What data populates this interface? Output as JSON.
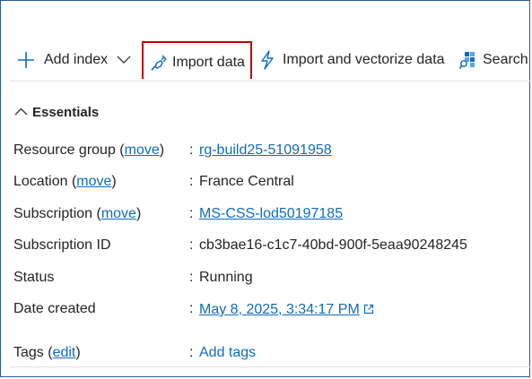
{
  "toolbar": {
    "add_index_label": "Add index",
    "import_data_label": "Import data",
    "import_vectorize_label": "Import and vectorize data",
    "search_label": "Search explorer"
  },
  "essentials": {
    "header": "Essentials",
    "open": "(",
    "close": ")",
    "resource_group": {
      "label": "Resource group",
      "action": "move",
      "value": "rg-build25-51091958"
    },
    "location": {
      "label": "Location",
      "action": "move",
      "value": "France Central"
    },
    "subscription": {
      "label": "Subscription",
      "action": "move",
      "value": "MS-CSS-lod50197185"
    },
    "subscription_id": {
      "label": "Subscription ID",
      "value": "cb3bae16-c1c7-40bd-900f-5eaa90248245"
    },
    "status": {
      "label": "Status",
      "value": "Running"
    },
    "date_created": {
      "label": "Date created",
      "value": "May 8, 2025, 3:34:17 PM"
    },
    "tags": {
      "label": "Tags",
      "action": "edit",
      "value": "Add tags"
    },
    "separator": ":"
  },
  "colors": {
    "accent": "#0f6cbd",
    "highlight_box": "#c00000",
    "frame": "#2b579a"
  },
  "icons": [
    "plus-icon",
    "chevron-down-icon",
    "plug-icon",
    "lightning-icon",
    "search-explorer-icon",
    "chevron-up-icon",
    "external-link-icon"
  ]
}
